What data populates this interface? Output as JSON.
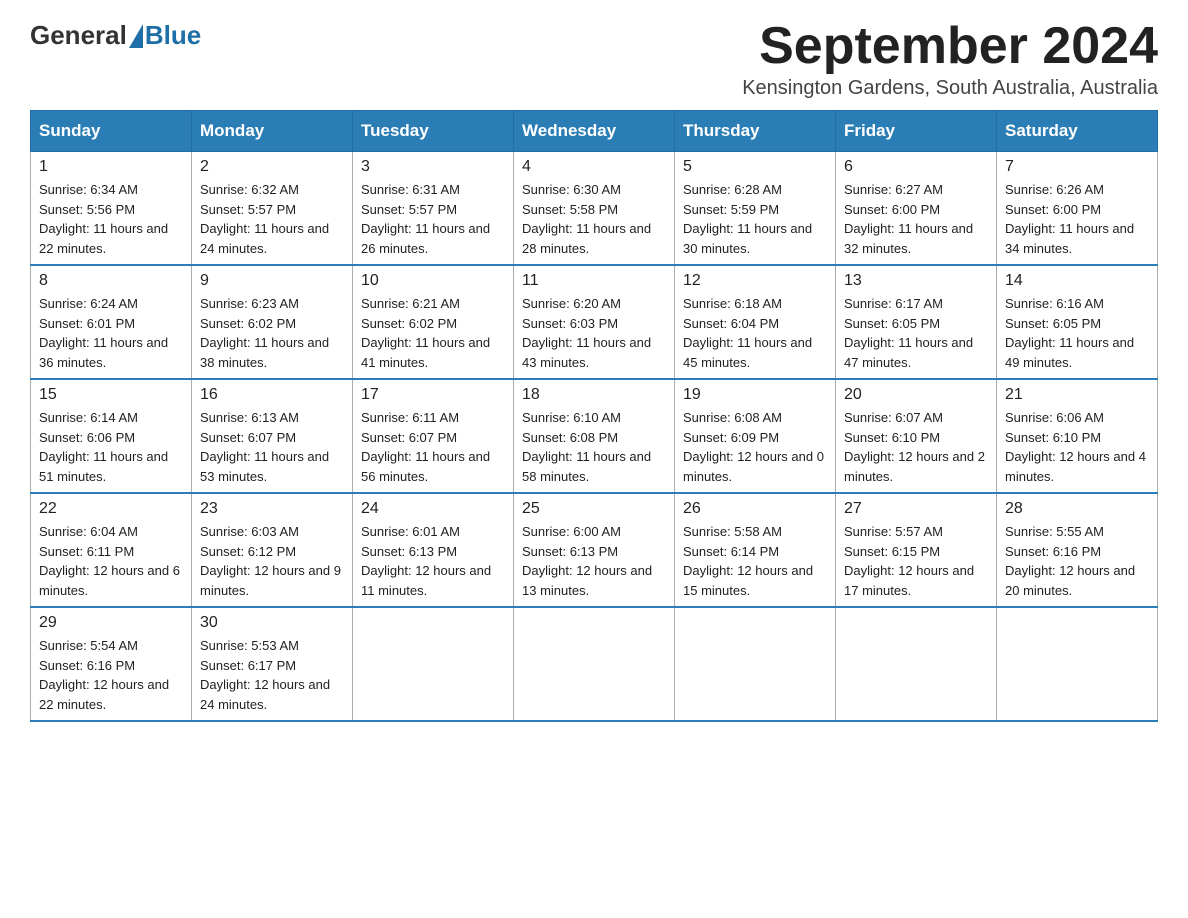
{
  "logo": {
    "text_before": "General",
    "text_after": "Blue"
  },
  "title": "September 2024",
  "location": "Kensington Gardens, South Australia, Australia",
  "days_of_week": [
    "Sunday",
    "Monday",
    "Tuesday",
    "Wednesday",
    "Thursday",
    "Friday",
    "Saturday"
  ],
  "weeks": [
    [
      {
        "day": "1",
        "sunrise": "6:34 AM",
        "sunset": "5:56 PM",
        "daylight": "11 hours and 22 minutes."
      },
      {
        "day": "2",
        "sunrise": "6:32 AM",
        "sunset": "5:57 PM",
        "daylight": "11 hours and 24 minutes."
      },
      {
        "day": "3",
        "sunrise": "6:31 AM",
        "sunset": "5:57 PM",
        "daylight": "11 hours and 26 minutes."
      },
      {
        "day": "4",
        "sunrise": "6:30 AM",
        "sunset": "5:58 PM",
        "daylight": "11 hours and 28 minutes."
      },
      {
        "day": "5",
        "sunrise": "6:28 AM",
        "sunset": "5:59 PM",
        "daylight": "11 hours and 30 minutes."
      },
      {
        "day": "6",
        "sunrise": "6:27 AM",
        "sunset": "6:00 PM",
        "daylight": "11 hours and 32 minutes."
      },
      {
        "day": "7",
        "sunrise": "6:26 AM",
        "sunset": "6:00 PM",
        "daylight": "11 hours and 34 minutes."
      }
    ],
    [
      {
        "day": "8",
        "sunrise": "6:24 AM",
        "sunset": "6:01 PM",
        "daylight": "11 hours and 36 minutes."
      },
      {
        "day": "9",
        "sunrise": "6:23 AM",
        "sunset": "6:02 PM",
        "daylight": "11 hours and 38 minutes."
      },
      {
        "day": "10",
        "sunrise": "6:21 AM",
        "sunset": "6:02 PM",
        "daylight": "11 hours and 41 minutes."
      },
      {
        "day": "11",
        "sunrise": "6:20 AM",
        "sunset": "6:03 PM",
        "daylight": "11 hours and 43 minutes."
      },
      {
        "day": "12",
        "sunrise": "6:18 AM",
        "sunset": "6:04 PM",
        "daylight": "11 hours and 45 minutes."
      },
      {
        "day": "13",
        "sunrise": "6:17 AM",
        "sunset": "6:05 PM",
        "daylight": "11 hours and 47 minutes."
      },
      {
        "day": "14",
        "sunrise": "6:16 AM",
        "sunset": "6:05 PM",
        "daylight": "11 hours and 49 minutes."
      }
    ],
    [
      {
        "day": "15",
        "sunrise": "6:14 AM",
        "sunset": "6:06 PM",
        "daylight": "11 hours and 51 minutes."
      },
      {
        "day": "16",
        "sunrise": "6:13 AM",
        "sunset": "6:07 PM",
        "daylight": "11 hours and 53 minutes."
      },
      {
        "day": "17",
        "sunrise": "6:11 AM",
        "sunset": "6:07 PM",
        "daylight": "11 hours and 56 minutes."
      },
      {
        "day": "18",
        "sunrise": "6:10 AM",
        "sunset": "6:08 PM",
        "daylight": "11 hours and 58 minutes."
      },
      {
        "day": "19",
        "sunrise": "6:08 AM",
        "sunset": "6:09 PM",
        "daylight": "12 hours and 0 minutes."
      },
      {
        "day": "20",
        "sunrise": "6:07 AM",
        "sunset": "6:10 PM",
        "daylight": "12 hours and 2 minutes."
      },
      {
        "day": "21",
        "sunrise": "6:06 AM",
        "sunset": "6:10 PM",
        "daylight": "12 hours and 4 minutes."
      }
    ],
    [
      {
        "day": "22",
        "sunrise": "6:04 AM",
        "sunset": "6:11 PM",
        "daylight": "12 hours and 6 minutes."
      },
      {
        "day": "23",
        "sunrise": "6:03 AM",
        "sunset": "6:12 PM",
        "daylight": "12 hours and 9 minutes."
      },
      {
        "day": "24",
        "sunrise": "6:01 AM",
        "sunset": "6:13 PM",
        "daylight": "12 hours and 11 minutes."
      },
      {
        "day": "25",
        "sunrise": "6:00 AM",
        "sunset": "6:13 PM",
        "daylight": "12 hours and 13 minutes."
      },
      {
        "day": "26",
        "sunrise": "5:58 AM",
        "sunset": "6:14 PM",
        "daylight": "12 hours and 15 minutes."
      },
      {
        "day": "27",
        "sunrise": "5:57 AM",
        "sunset": "6:15 PM",
        "daylight": "12 hours and 17 minutes."
      },
      {
        "day": "28",
        "sunrise": "5:55 AM",
        "sunset": "6:16 PM",
        "daylight": "12 hours and 20 minutes."
      }
    ],
    [
      {
        "day": "29",
        "sunrise": "5:54 AM",
        "sunset": "6:16 PM",
        "daylight": "12 hours and 22 minutes."
      },
      {
        "day": "30",
        "sunrise": "5:53 AM",
        "sunset": "6:17 PM",
        "daylight": "12 hours and 24 minutes."
      },
      null,
      null,
      null,
      null,
      null
    ]
  ]
}
